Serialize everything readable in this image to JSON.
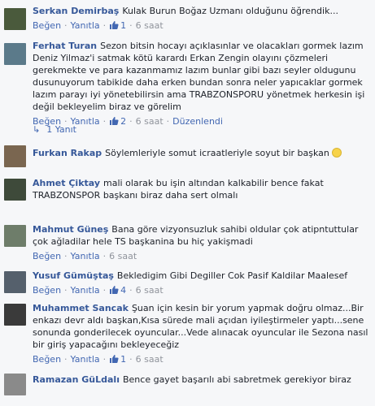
{
  "actions": {
    "like": "Beğen",
    "reply": "Yanıtla"
  },
  "comments": [
    {
      "author": "Serkan Demirbaş",
      "text": "Kulak Burun Boğaz Uzmanı olduğunu öğrendik...",
      "likes": "1",
      "time": "6 saat",
      "avatar_color": "#4a5a3c"
    },
    {
      "author": "Ferhat Turan",
      "text": "Sezon bitsin hocayı açıklasınlar ve olacakları gormek lazım Deniz Yilmaz'i satmak kötü karardı Erkan Zengin olayını çözmeleri gerekmekte ve para kazanmamız lazım bunlar gibi bazı seyler oldugunu dusunuyorum tabikide daha erken bundan sonra neler yapıcaklar gormek lazım parayı iyi yönetebilirsin ama TRABZONSPORU yönetmek herkesin işi değil bekleyelim biraz ve görelim",
      "likes": "2",
      "time": "6 saat",
      "edited": "Düzenlendi",
      "reply_count": "1 Yanıt",
      "avatar_color": "#5b7a8a"
    },
    {
      "author": "Furkan Rakap",
      "text": "Söylemleriyle somut icraatleriyle soyut bir başkan",
      "avatar_color": "#7a6650"
    },
    {
      "author": "Ahmet Çiktay",
      "text": "mali olarak bu işin altından kalkabilir bence fakat TRABZONSPOR başkanı biraz daha sert olmalı",
      "avatar_color": "#3e4a3a"
    },
    {
      "author": "Mahmut Güneş",
      "text": "Bana göre vizyonsuzluk sahibi oldular çok atipntuttular çok ağladilar hele TS başkanina bu hiç yakişmadi",
      "time": "6 saat",
      "avatar_color": "#6e7d6a"
    },
    {
      "author": "Yusuf Gümüştaş",
      "text": "Bekledigim Gibi Degiller Cok Pasif Kaldilar Maalesef",
      "likes": "4",
      "time": "6 saat",
      "avatar_color": "#55606c"
    },
    {
      "author": "Muhammet Sancak",
      "text": "Şuan için kesin bir yorum yapmak doğru olmaz...Bir enkazı devr aldı başkan,Kısa sürede mali açıdan iyileştirmeler yaptı...sene sonunda gonderilecek oyuncular...Vede alınacak oyuncular ile Sezona nasıl bir giriş yapacağını bekleyeceğiz",
      "likes": "1",
      "time": "6 saat",
      "avatar_color": "#3a3a3a"
    },
    {
      "author": "Ramazan GüLdalı",
      "text": "Bence gayet başarılı abi sabretmek gerekiyor biraz",
      "avatar_color": "#8a8a8a"
    }
  ]
}
